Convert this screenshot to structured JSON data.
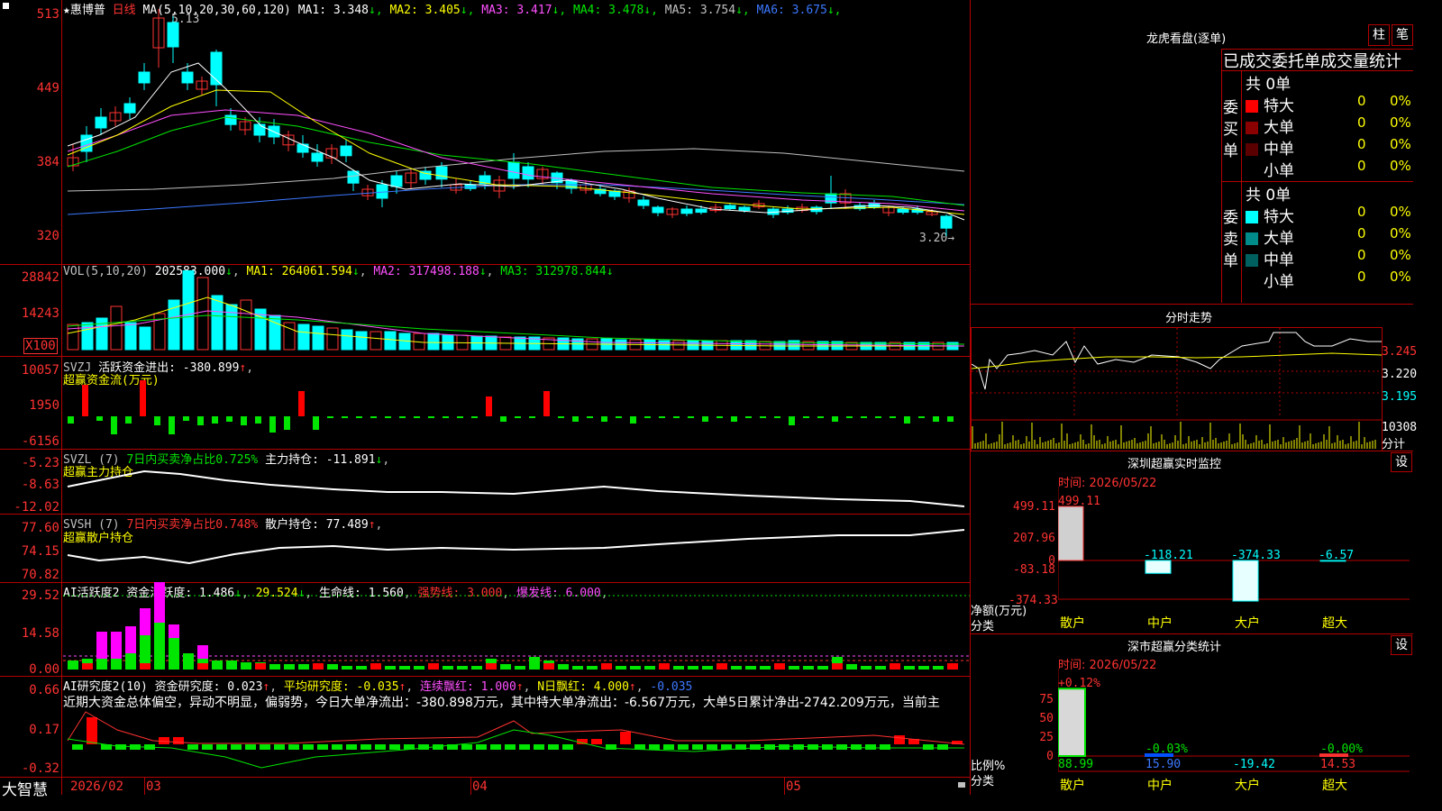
{
  "stock": {
    "star": "★",
    "name": "惠博普",
    "period": "日线"
  },
  "kline": {
    "ma_label": "MA(5,10,20,30,60,120)",
    "ma": [
      {
        "t": "MA1: 3.348",
        "a": "↓",
        "c": "#ffffff"
      },
      {
        "t": "MA2: 3.405",
        "a": "↓",
        "c": "#ffff00"
      },
      {
        "t": "MA3: 3.417",
        "a": "↓",
        "c": "#ff50ff"
      },
      {
        "t": "MA4: 3.478",
        "a": "↓",
        "c": "#00e600"
      },
      {
        "t": "MA5: 3.754",
        "a": "↓",
        "c": "#c0c0c0"
      },
      {
        "t": "MA6: 3.675",
        "a": "↓",
        "c": "#3c78ff"
      }
    ],
    "axis": [
      "513",
      "449",
      "384",
      "320"
    ],
    "high_label": "5.13",
    "low_label": "3.20→"
  },
  "vol": {
    "label": "VOL(5,10,20)",
    "value": "202583.000",
    "ma1": "MA1: 264061.594",
    "ma2": "MA2: 317498.188",
    "ma3": "MA3: 312978.844",
    "axis": [
      "28842",
      "14243"
    ],
    "unit": "X100"
  },
  "svzj": {
    "label": "SVZJ",
    "text": "活跃资金进出: -380.899",
    "sub": "超赢资金流(万元)",
    "axis": [
      "10057",
      "1950",
      "-6156"
    ]
  },
  "svzl": {
    "label": "SVZL (7)",
    "pct": "7日内买卖净占比0.725%",
    "hold": "主力持仓: -11.891",
    "sub": "超赢主力持仓",
    "axis": [
      "-5.23",
      "-8.63",
      "-12.02"
    ]
  },
  "svsh": {
    "label": "SVSH (7)",
    "pct": "7日内买卖净占比0.748%",
    "hold": "散户持仓: 77.489",
    "sub": "超赢散户持仓",
    "axis": [
      "77.60",
      "74.15",
      "70.82"
    ]
  },
  "ai1": {
    "label": "AI活跃度2",
    "t1": "资金活跃度: 1.486",
    "t2": "29.524",
    "t3": "生命线: 1.560",
    "t4": "强势线: 3.000",
    "t5": "爆发线: 6.000",
    "axis": [
      "29.52",
      "14.58",
      "0.00"
    ]
  },
  "ai2": {
    "label": "AI研究度2(10)",
    "t1": "资金研究度: 0.023",
    "t2": "平均研究度: -0.035",
    "t3": "连续飘红: 1.000",
    "t4": "N日飘红: 4.000",
    "t5": "-0.035",
    "axis": [
      "0.66",
      "0.17",
      "-0.32"
    ],
    "desc": "近期大资金总体偏空，异动不明显，偏弱势，今日大单净流出：-380.898万元，其中特大单净流出：-6.567万元，大单5日累计净出-2742.209万元，当前主"
  },
  "footer": {
    "brand": "大智慧",
    "dates": [
      "2026/02",
      "03",
      "04",
      "05"
    ]
  },
  "lhb": {
    "title": "龙虎看盘(逐单)",
    "btn1": "柱",
    "btn2": "笔",
    "head": "已成交委托单成交量统计",
    "buy_side": "委买单",
    "sell_side": "委卖单",
    "buy_total": "共 0单",
    "sell_total": "共 0单",
    "rows": [
      {
        "name": "特大",
        "n": "0",
        "p": "0%"
      },
      {
        "name": "大单",
        "n": "0",
        "p": "0%"
      },
      {
        "name": "中单",
        "n": "0",
        "p": "0%"
      },
      {
        "name": "小单",
        "n": "0",
        "p": "0%"
      }
    ],
    "buy_colors": [
      "#ff0000",
      "#8b0000",
      "#5a0000",
      ""
    ],
    "sell_colors": [
      "#00ffff",
      "#008b8b",
      "#006060",
      ""
    ]
  },
  "intraday": {
    "title": "分时走势",
    "prices": [
      "3.245",
      "3.220",
      "3.195"
    ],
    "vol": "10308",
    "unit": "分计"
  },
  "monitor": {
    "title": "深圳超赢实时监控",
    "btn": "设",
    "time": "时间: 2026/05/22",
    "axis": [
      "499.11",
      "207.96",
      "0",
      "-83.18",
      "-374.33"
    ],
    "ylabel": "净额(万元)",
    "xlabel": "分类",
    "bars": [
      {
        "cat": "散户",
        "v": "499.11"
      },
      {
        "cat": "中户",
        "v": "-118.21"
      },
      {
        "cat": "大户",
        "v": "-374.33"
      },
      {
        "cat": "超大",
        "v": "-6.57"
      }
    ]
  },
  "classify": {
    "title": "深市超赢分类统计",
    "btn": "设",
    "time": "时间: 2026/05/22",
    "axis": [
      "75",
      "50",
      "25",
      "0"
    ],
    "ylabel": "比例%",
    "xlabel": "分类",
    "bars": [
      {
        "cat": "散户",
        "top": "+0.12%",
        "bot": "88.99"
      },
      {
        "cat": "中户",
        "top": "-0.03%",
        "bot": "15.90"
      },
      {
        "cat": "大户",
        "top": "",
        "bot": "-19.42"
      },
      {
        "cat": "超大",
        "top": "-0.00%",
        "bot": "14.53"
      }
    ]
  }
}
